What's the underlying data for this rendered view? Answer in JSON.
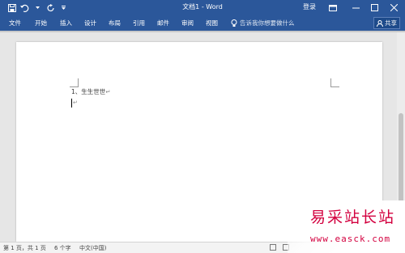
{
  "window": {
    "title": "文档1 - Word",
    "login_label": "登录"
  },
  "quick_access": {
    "icons": [
      "save-icon",
      "undo-icon",
      "redo-icon",
      "customize-icon"
    ]
  },
  "ribbon": {
    "tabs": [
      "文件",
      "开始",
      "插入",
      "设计",
      "布局",
      "引用",
      "邮件",
      "审阅",
      "视图"
    ],
    "tell_me": "告诉我你想要做什么",
    "share_label": "共享"
  },
  "document": {
    "line1_text": "1、生生世世",
    "paragraph_mark": "↵"
  },
  "status_bar": {
    "page_info": "第 1 页，共 1 页",
    "word_count": "6 个字",
    "language": "中文(中国)"
  },
  "watermark": {
    "line1": "易采站长站",
    "line2": "www.easck.com"
  },
  "colors": {
    "title_bar": "#2b579a",
    "watermark": "#d3003f"
  }
}
